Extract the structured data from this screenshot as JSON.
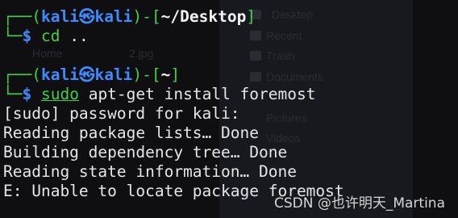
{
  "background_ghost": {
    "items": [
      "Desktop",
      "Recent",
      "Trash",
      "Documents",
      "Home",
      "2.jpg",
      "Pictures",
      "Videos"
    ]
  },
  "prompt1": {
    "corner_top": "┌──(",
    "user": "kali",
    "at": "㉿",
    "host": "kali",
    "sep": ")-[",
    "path": "~/Desktop",
    "close": "]",
    "corner_bottom": "└─",
    "dollar": "$",
    "command": "cd",
    "arg": ".."
  },
  "prompt2": {
    "corner_top": "┌──(",
    "user": "kali",
    "at": "㉿",
    "host": "kali",
    "sep": ")-[",
    "path": "~",
    "close": "]",
    "corner_bottom": "└─",
    "dollar": "$",
    "command": "sudo",
    "args": "apt-get install foremost"
  },
  "output": [
    "[sudo] password for kali:",
    "Reading package lists… Done",
    "Building dependency tree… Done",
    "Reading state information… Done",
    "E: Unable to locate package foremost"
  ],
  "watermark": "CSDN @也许明天_Martina",
  "colors": {
    "background": "#0f0f12",
    "prompt_blue": "#3d8bff",
    "prompt_green": "#3fcf4a",
    "text": "#e6e6e6"
  }
}
